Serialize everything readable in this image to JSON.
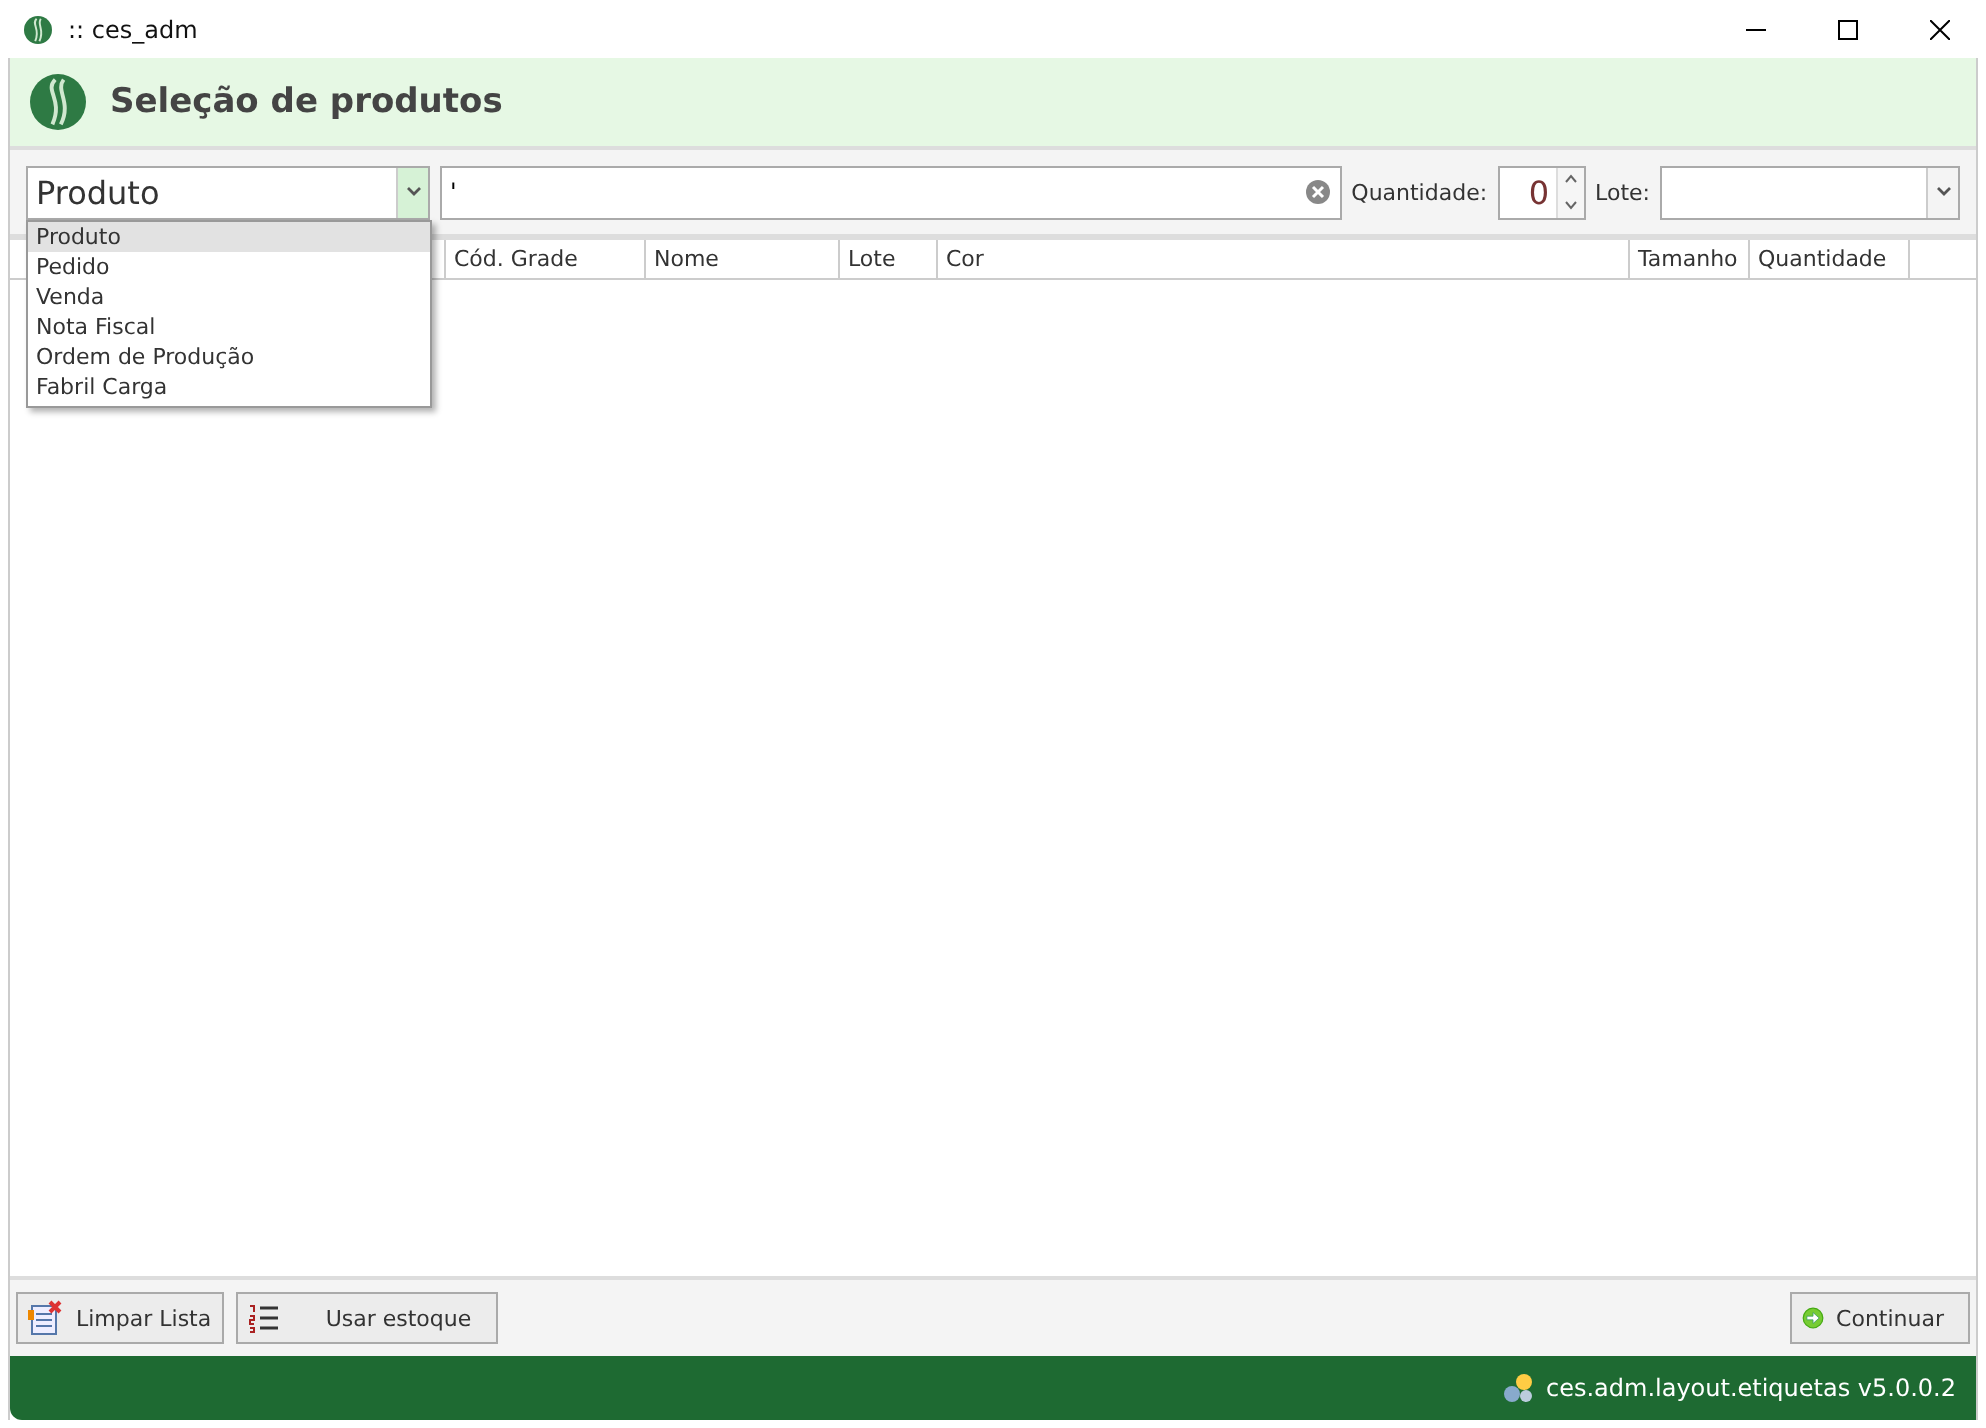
{
  "window": {
    "title": ":: ces_adm"
  },
  "header": {
    "title": "Seleção de produtos"
  },
  "toolbar": {
    "type_select": {
      "value": "Produto",
      "expanded": true,
      "options": [
        {
          "label": "Produto",
          "selected": true
        },
        {
          "label": "Pedido",
          "selected": false
        },
        {
          "label": "Venda",
          "selected": false
        },
        {
          "label": "Nota Fiscal",
          "selected": false
        },
        {
          "label": "Ordem de Produção",
          "selected": false
        },
        {
          "label": "Fabril Carga",
          "selected": false
        }
      ]
    },
    "search": {
      "value": "'"
    },
    "quantity": {
      "label": "Quantidade:",
      "value": "0"
    },
    "lot": {
      "label": "Lote:"
    }
  },
  "table": {
    "columns": [
      "Cód. Grade",
      "Nome",
      "Lote",
      "Cor",
      "Tamanho",
      "Quantidade"
    ]
  },
  "buttons": [
    {
      "label": "Limpar Lista",
      "kind": "clear"
    },
    {
      "label": "Usar estoque",
      "kind": "stock"
    },
    {
      "label": "Continuar",
      "kind": "continue"
    }
  ],
  "status_bar": {
    "text": "ces.adm.layout.etiquetas v5.0.0.2"
  }
}
